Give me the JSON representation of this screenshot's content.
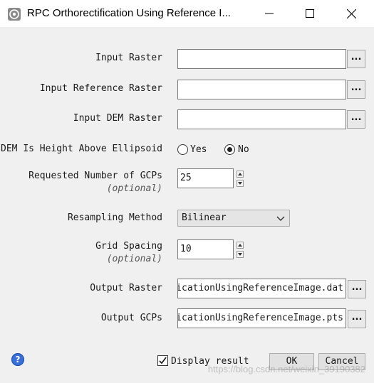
{
  "window": {
    "title": "RPC Orthorectification Using Reference I...",
    "minimize_icon": "minimize-icon",
    "maximize_icon": "maximize-icon",
    "close_icon": "close-icon"
  },
  "fields": {
    "input_raster": {
      "label": "Input Raster",
      "value": "",
      "browse": "..."
    },
    "input_reference_raster": {
      "label": "Input Reference Raster",
      "value": "",
      "browse": "..."
    },
    "input_dem_raster": {
      "label": "Input DEM Raster",
      "value": "",
      "browse": "..."
    },
    "dem_height": {
      "label": "DEM Is Height Above Ellipsoid",
      "options": [
        "Yes",
        "No"
      ],
      "selected": "No"
    },
    "gcps": {
      "label": "Requested Number of GCPs",
      "optional": "(optional)",
      "value": "25"
    },
    "resampling": {
      "label": "Resampling Method",
      "value": "Bilinear"
    },
    "grid_spacing": {
      "label": "Grid Spacing",
      "optional": "(optional)",
      "value": "10"
    },
    "output_raster": {
      "label": "Output Raster",
      "value": "ficationUsingReferenceImage.dat",
      "browse": "..."
    },
    "output_gcps": {
      "label": "Output GCPs",
      "value": "ficationUsingReferenceImage.pts",
      "browse": "..."
    }
  },
  "footer": {
    "help": "?",
    "display_result": "Display result",
    "display_result_checked": true,
    "ok": "OK",
    "cancel": "Cancel",
    "watermark": "https://blog.csdn.net/weixin_39190382"
  }
}
